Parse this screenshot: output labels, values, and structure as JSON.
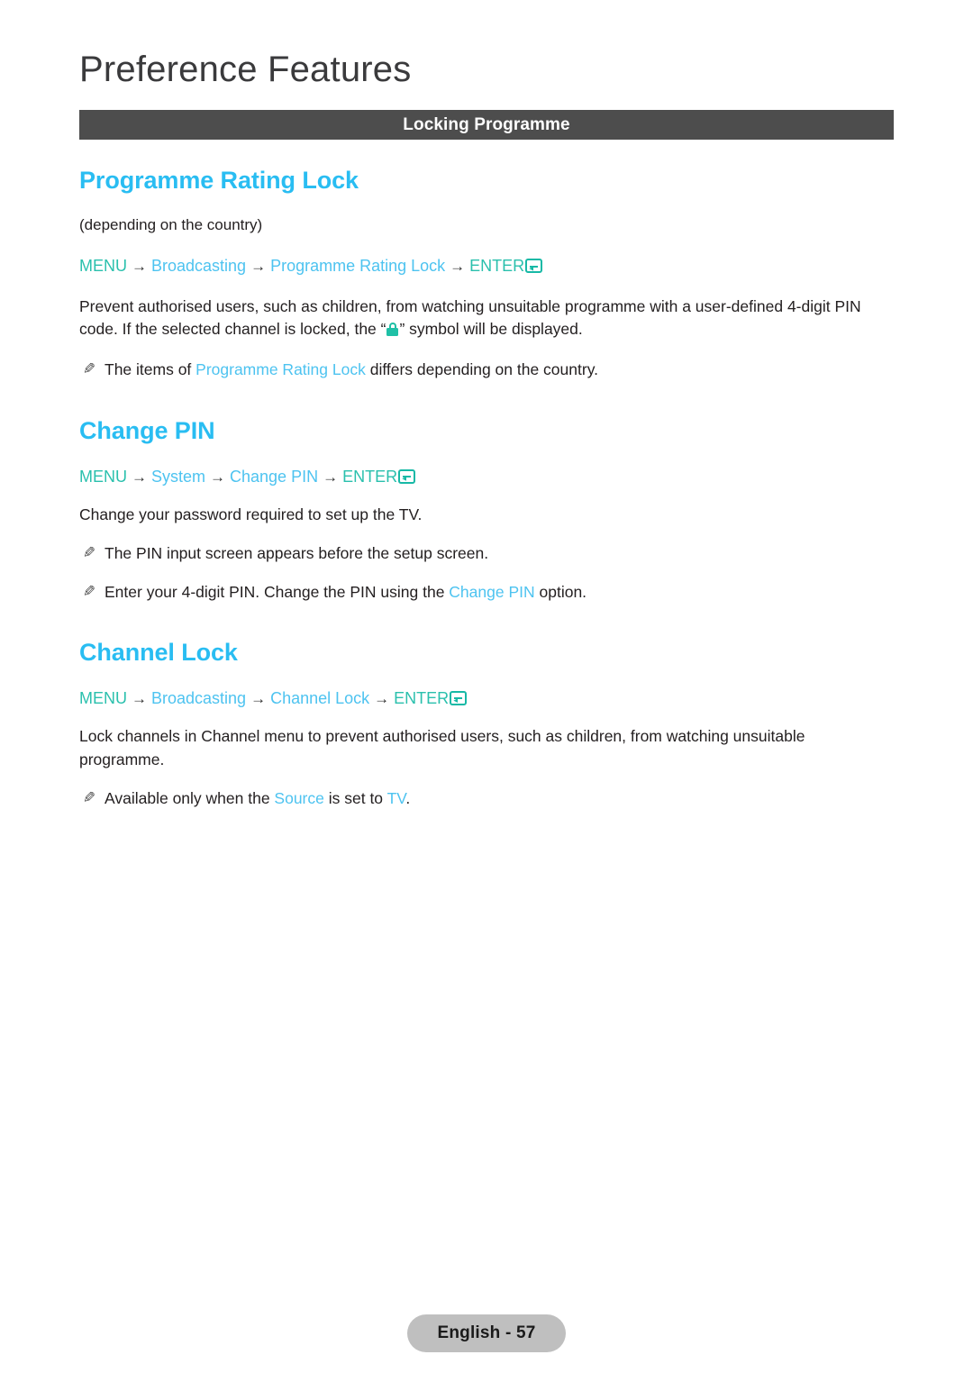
{
  "page": {
    "chapter_title": "Preference Features",
    "section_bar_label": "Locking Programme",
    "footer_label": "English - 57"
  },
  "colors": {
    "heading_blue": "#29bdf2",
    "link_blue": "#4dc3f0",
    "menu_teal": "#2ac0ad",
    "icon_teal": "#17b9a6",
    "lock_teal": "#1fc0a6",
    "bar_gray": "#4d4d4d",
    "footer_gray": "#bfbfbf",
    "body_text": "#231f20"
  },
  "icons": {
    "enter": "enter-return-key-icon",
    "lock": "padlock-icon",
    "note": "pencil-icon",
    "note_glyph": "✎",
    "arrow_glyph": "→"
  },
  "sections": [
    {
      "id": "programme-rating-lock",
      "heading": "Programme Rating Lock",
      "subnote": "(depending on the country)",
      "path": {
        "menu": "MENU",
        "items": [
          "Broadcasting",
          "Programme Rating Lock"
        ],
        "enter": "ENTER"
      },
      "body_before_lock": "Prevent authorised users, such as children, from watching unsuitable programme with a user-defined 4-digit PIN code. If the selected channel is locked, the “",
      "body_after_lock": "” symbol will be displayed.",
      "notes": [
        {
          "before": "The items of ",
          "link": "Programme Rating Lock",
          "after": " differs depending on the country."
        }
      ]
    },
    {
      "id": "change-pin",
      "heading": "Change PIN",
      "path": {
        "menu": "MENU",
        "items": [
          "System",
          "Change PIN"
        ],
        "enter": "ENTER"
      },
      "body": "Change your password required to set up the TV.",
      "notes": [
        {
          "before": "The PIN input screen appears before the setup screen.",
          "link": "",
          "after": ""
        },
        {
          "before": "Enter your 4-digit PIN. Change the PIN using the ",
          "link": "Change PIN",
          "after": " option."
        }
      ]
    },
    {
      "id": "channel-lock",
      "heading": "Channel Lock",
      "path": {
        "menu": "MENU",
        "items": [
          "Broadcasting",
          "Channel Lock"
        ],
        "enter": "ENTER"
      },
      "body": "Lock channels in Channel menu to prevent authorised users, such as children, from watching unsuitable programme.",
      "notes": [
        {
          "before": "Available only when the ",
          "link": "Source",
          "mid": " is set to ",
          "link2": "TV",
          "after": "."
        }
      ]
    }
  ]
}
